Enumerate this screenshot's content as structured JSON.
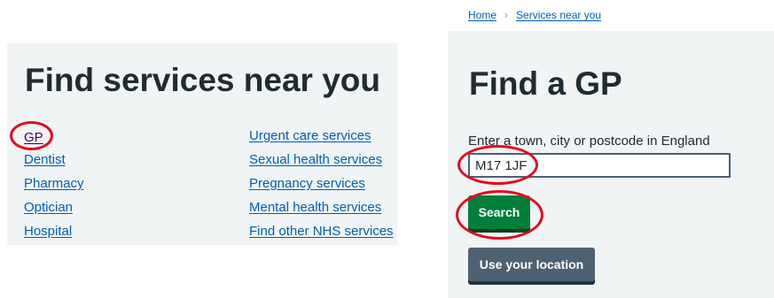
{
  "left_panel": {
    "title": "Find services near you",
    "links_col1": [
      "GP",
      "Dentist",
      "Pharmacy",
      "Optician",
      "Hospital"
    ],
    "links_col2": [
      "Urgent care services",
      "Sexual health services",
      "Pregnancy services",
      "Mental health services",
      "Find other NHS services"
    ]
  },
  "breadcrumb": {
    "home": "Home",
    "separator": "›",
    "current": "Services near you"
  },
  "right_panel": {
    "title": "Find a GP",
    "location_label": "Enter a town, city or postcode in England",
    "location_value": "M17 1JF",
    "search_button": "Search",
    "use_location_button": "Use your location"
  },
  "colors": {
    "link": "#005eb8",
    "visited_link": "#330072",
    "panel_bg": "#f0f4f5",
    "primary_button": "#007f3b",
    "secondary_button": "#4c6272",
    "annotation": "#e6091c"
  }
}
